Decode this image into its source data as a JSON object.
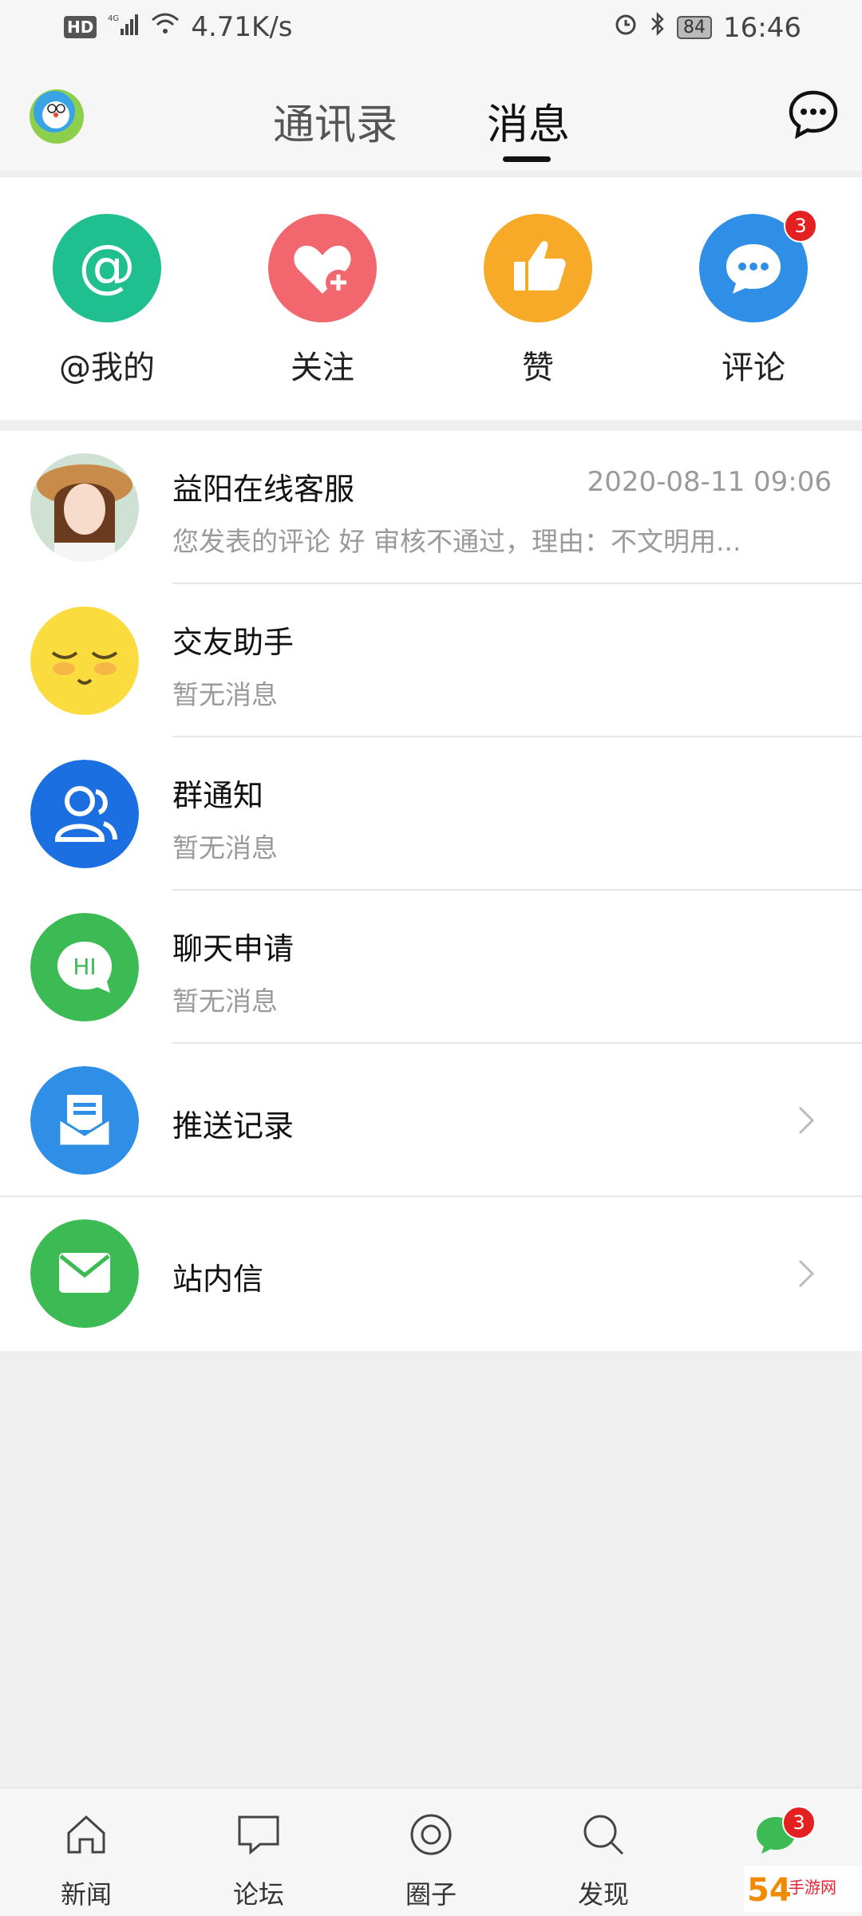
{
  "status_bar": {
    "network_badge": "HD",
    "signal_label": "4G",
    "speed": "4.71K/s",
    "battery": "84",
    "time": "16:46",
    "icons": [
      "signal-icon",
      "wifi-icon",
      "alarm-icon",
      "bluetooth-icon",
      "battery-icon"
    ]
  },
  "header": {
    "tabs": [
      {
        "label": "通讯录",
        "active": false
      },
      {
        "label": "消息",
        "active": true
      }
    ],
    "icons": [
      "app-logo-icon",
      "chat-bubble-icon"
    ]
  },
  "quick_actions": [
    {
      "label": "@我的",
      "icon": "at-icon",
      "color": "#1fbf8f"
    },
    {
      "label": "关注",
      "icon": "heart-plus-icon",
      "color": "#f2676d"
    },
    {
      "label": "赞",
      "icon": "thumbs-up-icon",
      "color": "#f7a928"
    },
    {
      "label": "评论",
      "icon": "comment-icon",
      "color": "#2f8fe6",
      "badge": "3"
    }
  ],
  "messages": [
    {
      "title": "益阳在线客服",
      "preview": "您发表的评论 好 审核不通过，理由：不文明用...",
      "time": "2020-08-11 09:06"
    },
    {
      "title": "交友助手",
      "preview": "暂无消息"
    },
    {
      "title": "群通知",
      "preview": "暂无消息"
    },
    {
      "title": "聊天申请",
      "preview": "暂无消息",
      "avatar_text": "HI"
    },
    {
      "title": "推送记录"
    },
    {
      "title": "站内信"
    }
  ],
  "bottom_nav": [
    {
      "label": "新闻",
      "icon": "home-icon"
    },
    {
      "label": "论坛",
      "icon": "forum-icon"
    },
    {
      "label": "圈子",
      "icon": "circle-icon"
    },
    {
      "label": "发现",
      "icon": "search-icon"
    },
    {
      "label": "",
      "icon": "message-icon",
      "badge": "3",
      "active": true
    }
  ],
  "colors": {
    "accent_green": "#3cba54",
    "badge_red": "#e52020"
  }
}
